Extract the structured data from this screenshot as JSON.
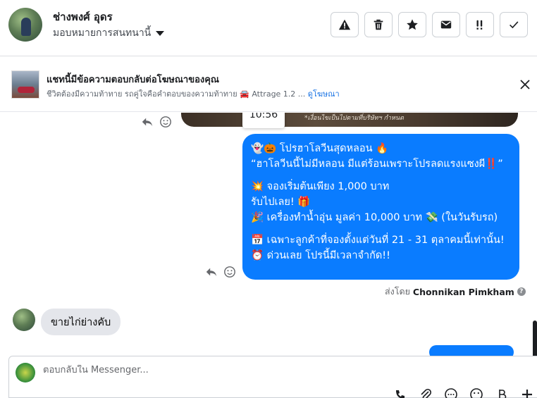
{
  "header": {
    "contact_name": "ช่างพงศ์ อุดร",
    "assign_label": "มอบหมายการสนทนานี้",
    "toolbar": [
      {
        "name": "report-button",
        "icon": "warning-icon"
      },
      {
        "name": "delete-button",
        "icon": "trash-icon"
      },
      {
        "name": "star-button",
        "icon": "star-icon"
      },
      {
        "name": "mail-button",
        "icon": "envelope-icon"
      },
      {
        "name": "priority-button",
        "icon": "exclamation-icon"
      },
      {
        "name": "done-button",
        "icon": "check-icon"
      }
    ]
  },
  "ad_banner": {
    "title": "แชทนี้มีข้อความตอบกลับต่อโฆษณาของคุณ",
    "subtitle": "ชีวิตต้องมีความท้าทาย รถคู่ใจคือคำตอบของความท้าทาย 🚘 Attrage 1.2 ...",
    "link_label": "ดูโฆษณา"
  },
  "chat": {
    "image_caption": "*เงื่อนไขเป็นไปตามที่บริษัทฯ กำหนด",
    "timestamp_tooltip": "10:56",
    "outgoing_message": {
      "lines": [
        "👻🎃 โปรฮาโลวีนสุดหลอน 🔥",
        "“ฮาโลวีนนี้ไม่มีหลอน มีแต่ร้อนเพราะโปรลดแรงแซงผี‼️”",
        "",
        "💥 จองเริ่มต้นเพียง 1,000 บาท",
        "รับไปเลย! 🎁",
        "🎉 เครื่องทำน้ำอุ่น มูลค่า 10,000 บาท 💸 (ในวันรับรถ)",
        "",
        "📅 เฉพาะลูกค้าที่จองตั้งแต่วันที่ 21 - 31 ตุลาคมนี้เท่านั้น!",
        "⏰ ด่วนเลย โปรนี้มีเวลาจำกัด!!"
      ]
    },
    "sent_by_prefix": "ส่งโดย",
    "sent_by_name": "Chonnikan Pimkham",
    "incoming_message": "ขายไก่ย่างคับ"
  },
  "composer": {
    "placeholder": "ตอบกลับใน Messenger..."
  },
  "colors": {
    "accent": "#0a7cff",
    "link": "#1b74e4",
    "incoming_bubble": "#e4e6eb"
  }
}
